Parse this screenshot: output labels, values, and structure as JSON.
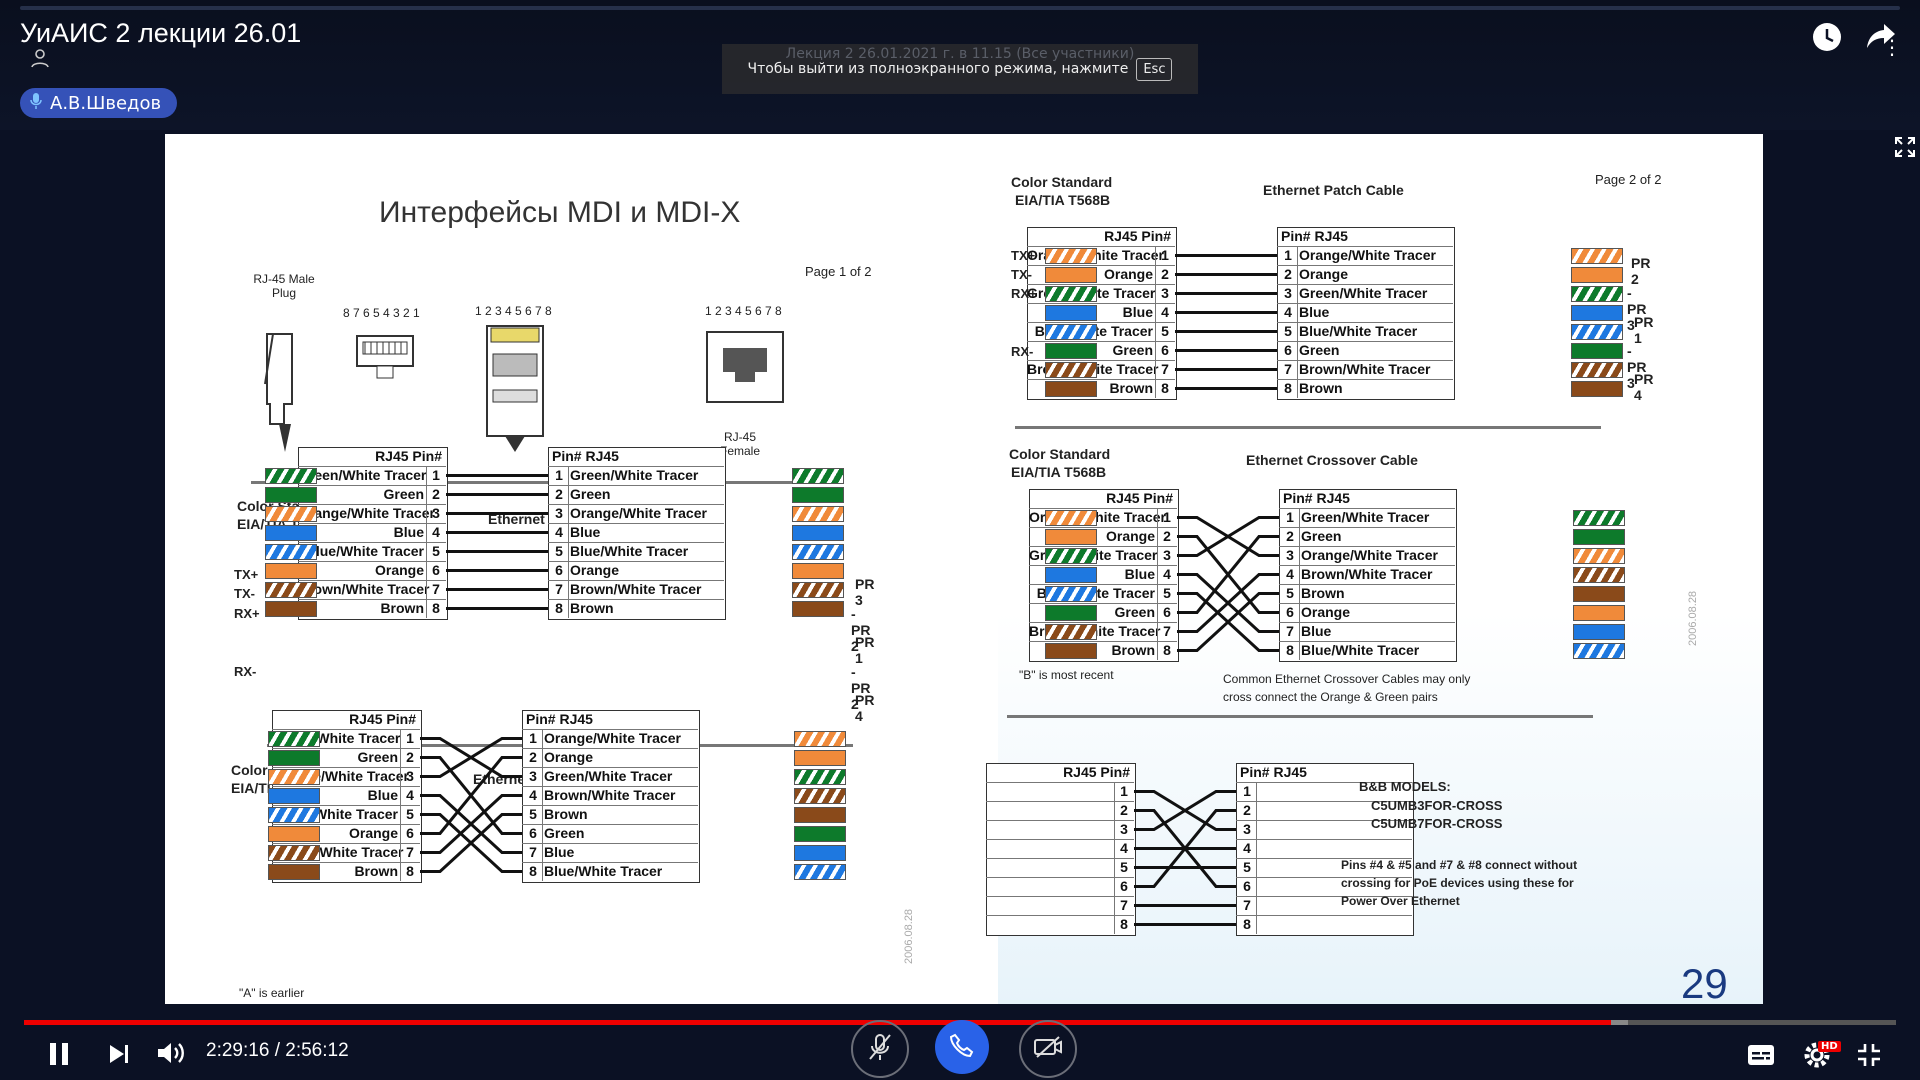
{
  "window": {
    "video_title": "УиАИС 2 лекции 26.01",
    "speaker_name": "А.В.Шведов",
    "fullscreen_toast": "Чтобы выйти из полноэкранного режима, нажмите",
    "fullscreen_key": "Esc",
    "background_meeting_title": "Лекция 2 26.01.2021 г. в 11.15 (Все участники)"
  },
  "player": {
    "current_time": "2:29:16",
    "separator": "/",
    "duration": "2:56:12",
    "progress_fraction": 0.848,
    "buffer_fraction": 0.857
  },
  "slide": {
    "title": "Интерфейсы MDI и MDI-X",
    "page_left": "Page 1 of 2",
    "page_right": "Page 2 of 2",
    "slide_number": "29",
    "plug_label": "RJ-45 Male Plug",
    "plug_numbers_rev": "8 7 6 5 4 3 2 1",
    "plug_numbers": "1 2 3 4 5 6 7 8",
    "female_numbers": "1 2 3 4 5 6 7 8",
    "female_label": "RJ-45 Female",
    "color_std_a": "Color Standard",
    "std_a": "EIA/TIA T568A",
    "std_b": "EIA/TIA T568B",
    "patch_title": "Ethernet Patch Cable",
    "cross_title": "Ethernet Crossover Cable",
    "hdr_left": "RJ45  Pin#",
    "hdr_right": "Pin#  RJ45",
    "a_note": "\"A\" is earlier",
    "b_note": "\"B\" is most recent",
    "cross_note_1": "Common Ethernet Crossover Cables may only",
    "cross_note_2": "cross connect the Orange & Green pairs",
    "date_stamp": "2006.08.28",
    "bb_models": "B&B MODELS:",
    "bb_model_1": "C5UMB3FOR-CROSS",
    "bb_model_2": "C5UMB7FOR-CROSS",
    "poe_1": "Pins #4 & #5 and #7 & #8 connect without",
    "poe_2": "crossing for PoE devices using these for",
    "poe_3": "Power Over Ethernet",
    "labels": {
      "txp": "TX+",
      "txm": "TX-",
      "rxp": "RX+",
      "rxm": "RX-",
      "pr1": "PR 1",
      "pr2": "PR 2",
      "pr3": "PR 3",
      "pr4": "PR 4",
      "pr2d": "-PR 2",
      "pr3d": "-PR 3"
    },
    "a_pins": [
      "Green/White Tracer",
      "Green",
      "Orange/White Tracer",
      "Blue",
      "Blue/White Tracer",
      "Orange",
      "Brown/White Tracer",
      "Brown"
    ],
    "a_cross_right": [
      "Orange/White Tracer",
      "Orange",
      "Green/White Tracer",
      "Brown/White Tracer",
      "Brown",
      "Green",
      "Blue",
      "Blue/White Tracer"
    ],
    "b_pins": [
      "Orange/White Tracer",
      "Orange",
      "Green/White Tracer",
      "Blue",
      "Blue/White Tracer",
      "Green",
      "Brown/White Tracer",
      "Brown"
    ],
    "b_cross_right": [
      "Green/White Tracer",
      "Green",
      "Orange/White Tracer",
      "Brown/White Tracer",
      "Brown",
      "Orange",
      "Blue",
      "Blue/White Tracer"
    ],
    "a_pins_right": [
      "Green/White Tracer",
      "Green",
      "Orange/White Tracer",
      "Blue",
      "Blue/White Tracer",
      "Orange",
      "Brown/White Tracer",
      "Brown"
    ],
    "b_pins_right": [
      "Orange/White Tracer",
      "Orange",
      "Green/White Tracer",
      "Blue",
      "Blue/White Tracer",
      "Green",
      "Brown/White Tracer",
      "Brown"
    ],
    "pin_numbers": [
      "1",
      "2",
      "3",
      "4",
      "5",
      "6",
      "7",
      "8"
    ]
  },
  "colors": {
    "green": "#0d7a2b",
    "orange": "#f08a3a",
    "blue": "#1e78e0",
    "brown": "#8a4a1a",
    "accent_red": "#e00000",
    "speaker_chip": "#3552b8"
  },
  "icons": {
    "top_right": [
      "clock-icon",
      "share-icon"
    ],
    "controls": [
      "pause-icon",
      "next-icon",
      "volume-icon",
      "mic-off-icon",
      "call-icon",
      "camera-off-icon",
      "captions-icon",
      "settings-icon",
      "exit-fullscreen-icon"
    ]
  },
  "settings_badge": "HD"
}
